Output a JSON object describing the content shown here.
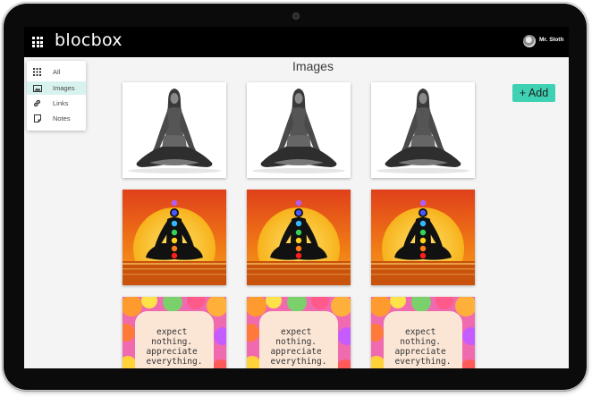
{
  "app": {
    "brand": "blocbox",
    "user_name": "Mr. Sloth"
  },
  "page": {
    "title": "Images"
  },
  "menu": {
    "items": [
      {
        "label": "All",
        "icon": "grid-icon",
        "active": false
      },
      {
        "label": "Images",
        "icon": "image-icon",
        "active": true
      },
      {
        "label": "Links",
        "icon": "link-icon",
        "active": false
      },
      {
        "label": "Notes",
        "icon": "note-icon",
        "active": false
      }
    ]
  },
  "actions": {
    "add_label": "+ Add"
  },
  "gallery": {
    "rows": [
      {
        "kind": "meditation-photo"
      },
      {
        "kind": "chakra-sunset"
      },
      {
        "kind": "quote-card",
        "quote_lines": [
          "expect",
          "nothing.",
          "appreciate",
          "everything."
        ]
      }
    ]
  },
  "colors": {
    "accent": "#3fd1b3",
    "topbar": "#000000",
    "active_menu": "#d8f3ef"
  }
}
